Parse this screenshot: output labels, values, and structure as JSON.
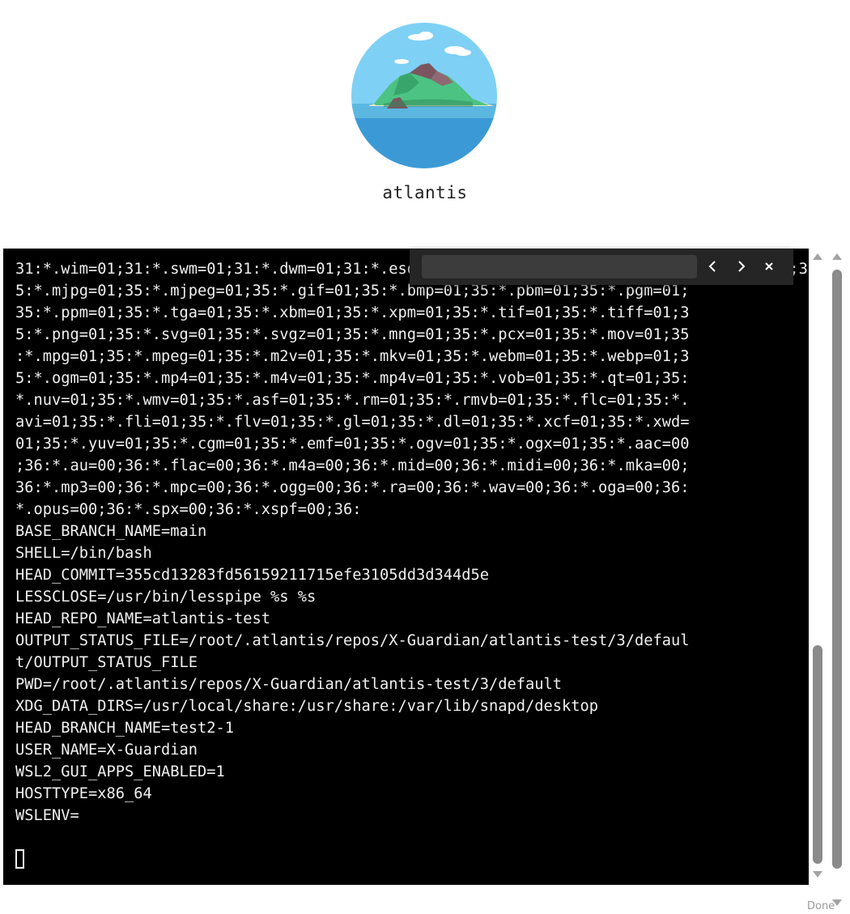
{
  "app": {
    "name": "atlantis"
  },
  "terminal": {
    "lines": [
      "31:*.wim=01;31:*.swm=01;31:*.dwm=01;31:*.esd=01;31:*.avif=01;35:*.jpg=01;35:*.jpeg=01;3",
      "5:*.mjpg=01;35:*.mjpeg=01;35:*.gif=01;35:*.bmp=01;35:*.pbm=01;35:*.pgm=01;",
      "35:*.ppm=01;35:*.tga=01;35:*.xbm=01;35:*.xpm=01;35:*.tif=01;35:*.tiff=01;3",
      "5:*.png=01;35:*.svg=01;35:*.svgz=01;35:*.mng=01;35:*.pcx=01;35:*.mov=01;35",
      ":*.mpg=01;35:*.mpeg=01;35:*.m2v=01;35:*.mkv=01;35:*.webm=01;35:*.webp=01;3",
      "5:*.ogm=01;35:*.mp4=01;35:*.m4v=01;35:*.mp4v=01;35:*.vob=01;35:*.qt=01;35:",
      "*.nuv=01;35:*.wmv=01;35:*.asf=01;35:*.rm=01;35:*.rmvb=01;35:*.flc=01;35:*.",
      "avi=01;35:*.fli=01;35:*.flv=01;35:*.gl=01;35:*.dl=01;35:*.xcf=01;35:*.xwd=",
      "01;35:*.yuv=01;35:*.cgm=01;35:*.emf=01;35:*.ogv=01;35:*.ogx=01;35:*.aac=00",
      ";36:*.au=00;36:*.flac=00;36:*.m4a=00;36:*.mid=00;36:*.midi=00;36:*.mka=00;",
      "36:*.mp3=00;36:*.mpc=00;36:*.ogg=00;36:*.ra=00;36:*.wav=00;36:*.oga=00;36:",
      "*.opus=00;36:*.spx=00;36:*.xspf=00;36:",
      "BASE_BRANCH_NAME=main",
      "SHELL=/bin/bash",
      "HEAD_COMMIT=355cd13283fd56159211715efe3105dd3d344d5e",
      "LESSCLOSE=/usr/bin/lesspipe %s %s",
      "HEAD_REPO_NAME=atlantis-test",
      "OUTPUT_STATUS_FILE=/root/.atlantis/repos/X-Guardian/atlantis-test/3/defaul",
      "t/OUTPUT_STATUS_FILE",
      "PWD=/root/.atlantis/repos/X-Guardian/atlantis-test/3/default",
      "XDG_DATA_DIRS=/usr/local/share:/usr/share:/var/lib/snapd/desktop",
      "HEAD_BRANCH_NAME=test2-1",
      "USER_NAME=X-Guardian",
      "WSL2_GUI_APPS_ENABLED=1",
      "HOSTTYPE=x86_64",
      "WSLENV=",
      ""
    ]
  },
  "find_bar": {
    "query": "",
    "previous_glyph": "‹",
    "next_glyph": "›",
    "close_glyph": "✕"
  },
  "status_bar": {
    "text": "Done"
  },
  "colors": {
    "terminal_bg": "#000000",
    "terminal_fg": "#f0f0f0",
    "find_bar_bg": "#252526",
    "scroll_thumb": "#8a8a8a",
    "sky": "#7fd0f5",
    "sea": "#3b9ad6",
    "island": "#4cc383"
  },
  "icons": {
    "avatar": "island-icon",
    "find_previous": "chevron-left-icon",
    "find_next": "chevron-right-icon",
    "find_close": "close-icon",
    "scroll_up": "arrow-up-icon",
    "scroll_down": "arrow-down-icon"
  }
}
